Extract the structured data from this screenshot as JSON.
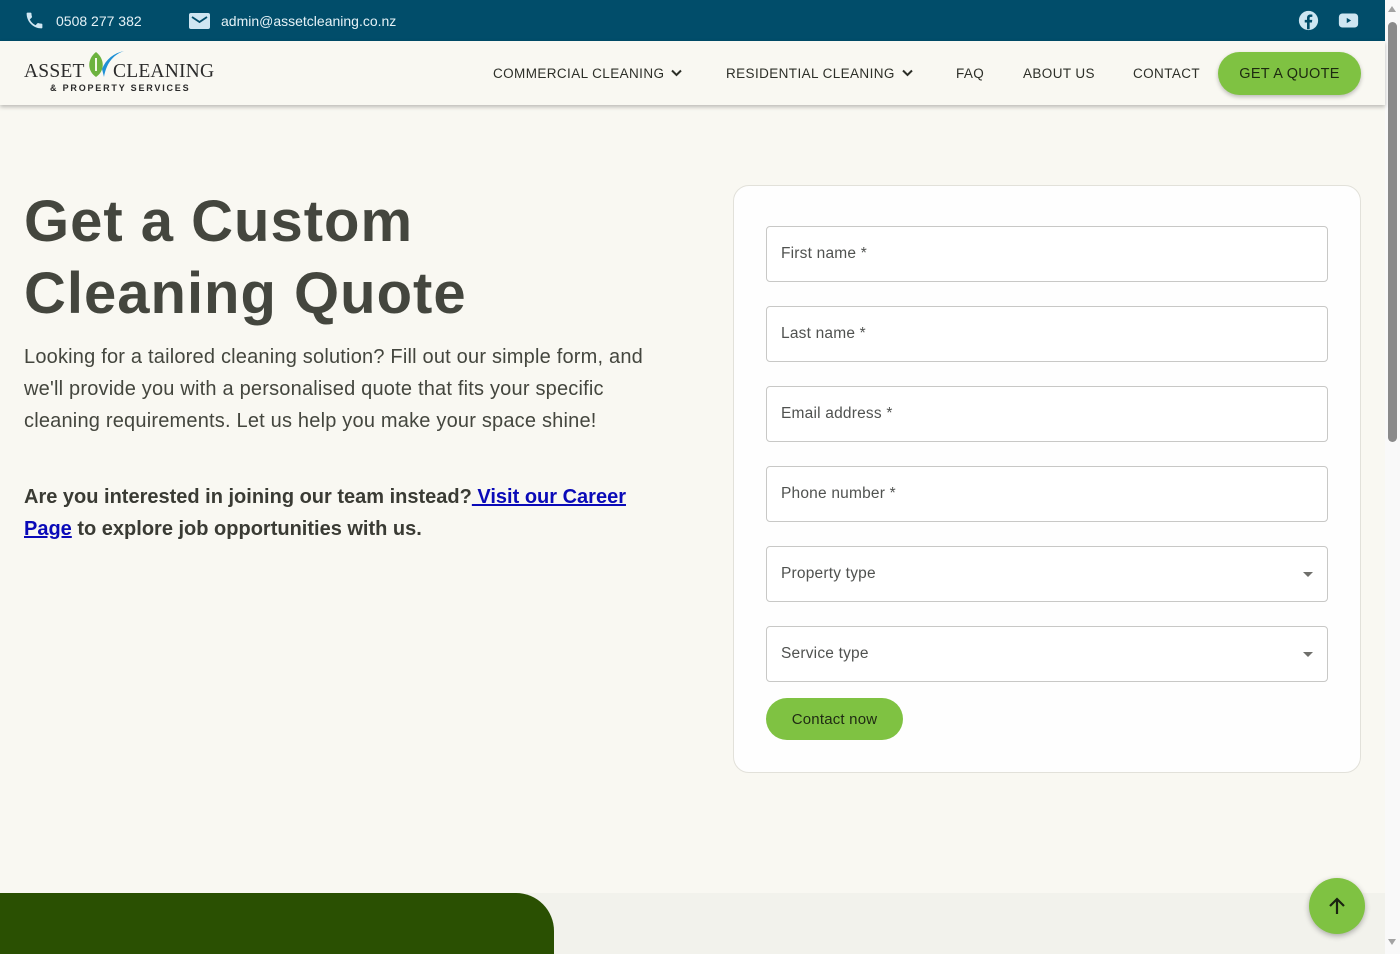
{
  "topbar": {
    "phone": "0508 277 382",
    "email": "admin@assetcleaning.co.nz",
    "social": [
      "facebook-icon",
      "youtube-icon"
    ]
  },
  "logo": {
    "word1": "ASSET",
    "word2": "CLEANING",
    "tagline": "& PROPERTY SERVICES"
  },
  "nav": {
    "items": [
      {
        "label": "COMMERCIAL CLEANING",
        "dropdown": true
      },
      {
        "label": "RESIDENTIAL CLEANING",
        "dropdown": true
      },
      {
        "label": "FAQ",
        "dropdown": false
      },
      {
        "label": "ABOUT US",
        "dropdown": false
      },
      {
        "label": "CONTACT",
        "dropdown": false
      }
    ],
    "cta": "GET A QUOTE"
  },
  "hero": {
    "title_line1": "Get a Custom",
    "title_line2": "Cleaning Quote",
    "lead": "Looking for a tailored cleaning solution? Fill out our simple form, and we'll provide you with a personalised quote that fits your specific cleaning requirements. Let us help you make your space shine!",
    "career_prefix": "Are you interested in joining our team instead?",
    "career_link": " Visit our Career Page",
    "career_suffix": " to explore job opportunities with us."
  },
  "form": {
    "fields": [
      {
        "label": "First name *",
        "type": "text",
        "value": ""
      },
      {
        "label": "Last name *",
        "type": "text",
        "value": ""
      },
      {
        "label": "Email address *",
        "type": "email",
        "value": ""
      },
      {
        "label": "Phone number *",
        "type": "tel",
        "value": ""
      },
      {
        "label": "Property type",
        "type": "select",
        "value": ""
      },
      {
        "label": "Service type",
        "type": "select",
        "value": ""
      }
    ],
    "submit": "Contact now"
  },
  "colors": {
    "topbar": "#014d6a",
    "accent_green": "#7fc242",
    "footer_green": "#2a5002",
    "background": "#f9f8f2",
    "link": "#0a0ab8"
  }
}
